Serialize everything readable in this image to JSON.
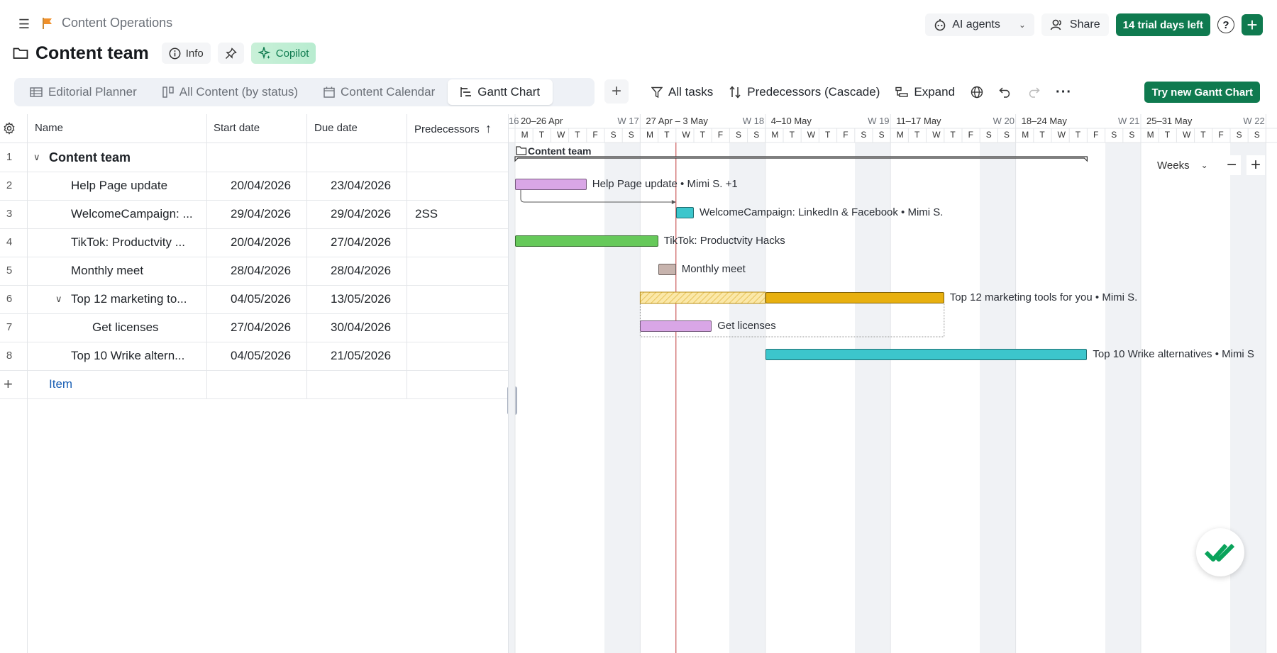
{
  "header": {
    "space_name": "Content Operations",
    "ai_agents_label": "AI agents",
    "share_label": "Share",
    "trial_label": "14 trial days left",
    "help_label": "?"
  },
  "page": {
    "title": "Content team",
    "info_label": "Info",
    "copilot_label": "Copilot"
  },
  "tabs": [
    {
      "label": "Editorial Planner",
      "icon": "table-icon"
    },
    {
      "label": "All Content (by status)",
      "icon": "board-icon"
    },
    {
      "label": "Content Calendar",
      "icon": "calendar-icon"
    },
    {
      "label": "Gantt Chart",
      "icon": "gantt-icon",
      "active": true
    }
  ],
  "toolbar": {
    "filter_label": "All tasks",
    "predecessors_label": "Predecessors (Cascade)",
    "expand_label": "Expand",
    "try_gantt_label": "Try new Gantt Chart"
  },
  "grid": {
    "columns": [
      "Name",
      "Start date",
      "Due date",
      "Predecessors"
    ],
    "rows": [
      {
        "num": "1",
        "name": "Content team",
        "start": "",
        "due": "",
        "pred": "",
        "level": 0,
        "bold": true,
        "toggle": "∨"
      },
      {
        "num": "2",
        "name": "Help Page update",
        "start": "20/04/2026",
        "due": "23/04/2026",
        "pred": "",
        "level": 1
      },
      {
        "num": "3",
        "name": "WelcomeCampaign: ...",
        "start": "29/04/2026",
        "due": "29/04/2026",
        "pred": "2SS",
        "level": 1
      },
      {
        "num": "4",
        "name": "TikTok: Productvity ...",
        "start": "20/04/2026",
        "due": "27/04/2026",
        "pred": "",
        "level": 1
      },
      {
        "num": "5",
        "name": "Monthly meet",
        "start": "28/04/2026",
        "due": "28/04/2026",
        "pred": "",
        "level": 1
      },
      {
        "num": "6",
        "name": "Top 12 marketing to...",
        "start": "04/05/2026",
        "due": "13/05/2026",
        "pred": "",
        "level": 1,
        "toggle": "∨"
      },
      {
        "num": "7",
        "name": "Get licenses",
        "start": "27/04/2026",
        "due": "30/04/2026",
        "pred": "",
        "level": 2
      },
      {
        "num": "8",
        "name": "Top 10 Wrike altern...",
        "start": "04/05/2026",
        "due": "21/05/2026",
        "pred": "",
        "level": 1
      }
    ],
    "add_item_label": "Item"
  },
  "gantt": {
    "weeks": [
      {
        "range": "",
        "num": "16"
      },
      {
        "range": "20–26 Apr",
        "num": "W 17"
      },
      {
        "range": "27 Apr – 3 May",
        "num": "W 18"
      },
      {
        "range": "4–10 May",
        "num": "W 19"
      },
      {
        "range": "11–17 May",
        "num": "W 20"
      },
      {
        "range": "18–24 May",
        "num": "W 21"
      },
      {
        "range": "25–31 May",
        "num": "W 22"
      }
    ],
    "first_day_letter": "S",
    "day_letters": [
      "M",
      "T",
      "W",
      "T",
      "F",
      "S",
      "S"
    ],
    "scale_label": "Weeks",
    "group_label": "Content team",
    "bars": [
      {
        "label": "Help Page update • Mimi S. +1",
        "color": "#d9a6e6"
      },
      {
        "label": "WelcomeCampaign: LinkedIn & Facebook • Mimi S.",
        "color": "#3cc6cc"
      },
      {
        "label": "TikTok: Productvity Hacks",
        "color": "#66c95a"
      },
      {
        "label": "Monthly meet",
        "color": "#c7b3ad"
      },
      {
        "label": "Top 12 marketing tools for you • Mimi S.",
        "color": "#e8b00f"
      },
      {
        "label": "Get licenses",
        "color": "#d9a6e6"
      },
      {
        "label": "Top 10 Wrike alternatives • Mimi S",
        "color": "#3cc6cc"
      }
    ]
  }
}
